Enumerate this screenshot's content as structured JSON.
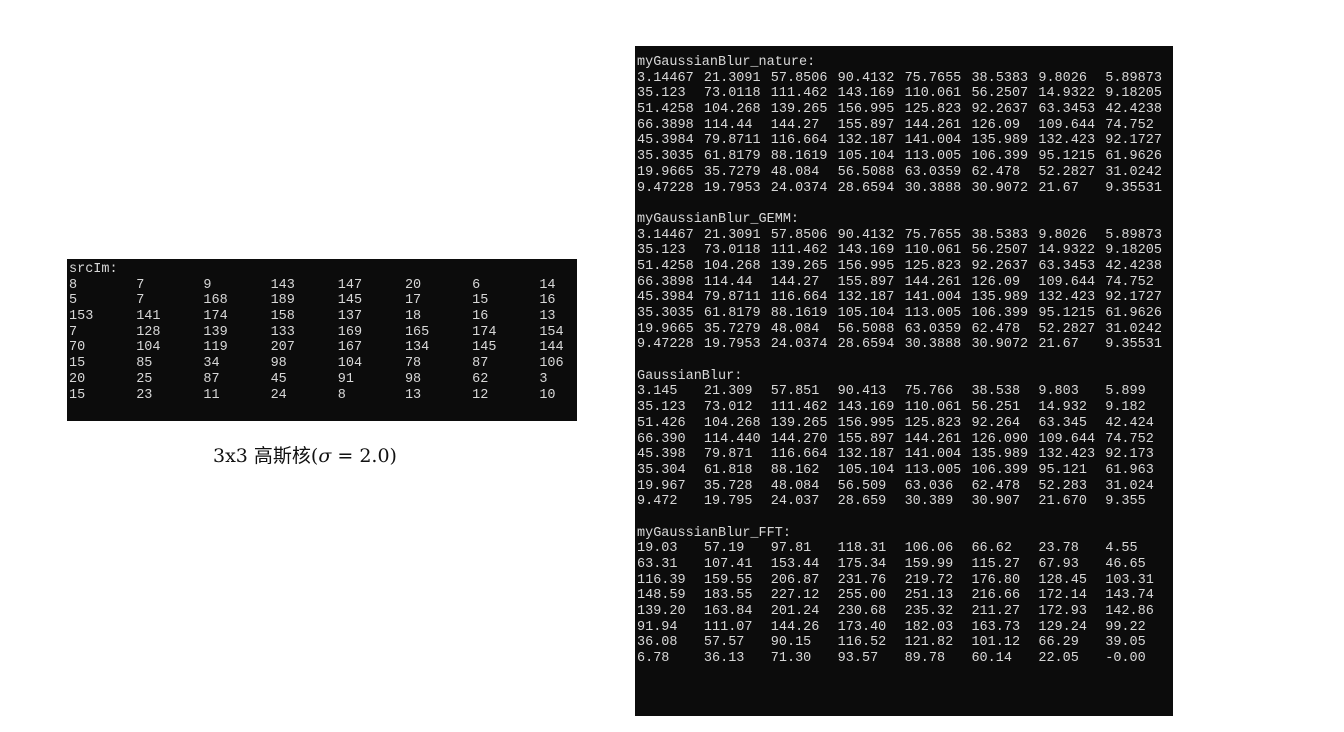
{
  "src_console": {
    "header": "srcIm:",
    "rows": [
      [
        "8",
        "7",
        "9",
        "143",
        "147",
        "20",
        "6",
        "14"
      ],
      [
        "5",
        "7",
        "168",
        "189",
        "145",
        "17",
        "15",
        "16"
      ],
      [
        "153",
        "141",
        "174",
        "158",
        "137",
        "18",
        "16",
        "13"
      ],
      [
        "7",
        "128",
        "139",
        "133",
        "169",
        "165",
        "174",
        "154"
      ],
      [
        "70",
        "104",
        "119",
        "207",
        "167",
        "134",
        "145",
        "144"
      ],
      [
        "15",
        "85",
        "34",
        "98",
        "104",
        "78",
        "87",
        "106"
      ],
      [
        "20",
        "25",
        "87",
        "45",
        "91",
        "98",
        "62",
        "3"
      ],
      [
        "15",
        "23",
        "11",
        "24",
        "8",
        "13",
        "12",
        "10"
      ]
    ]
  },
  "caption": {
    "prefix": "3x3 高斯核(",
    "symbol": "σ",
    "suffix": " = 2.0)"
  },
  "result_console": {
    "blocks": [
      {
        "header": "myGaussianBlur_nature:",
        "rows": [
          [
            "3.14467",
            "21.3091",
            "57.8506",
            "90.4132",
            "75.7655",
            "38.5383",
            "9.8026",
            "5.89873"
          ],
          [
            "35.123",
            "73.0118",
            "111.462",
            "143.169",
            "110.061",
            "56.2507",
            "14.9322",
            "9.18205"
          ],
          [
            "51.4258",
            "104.268",
            "139.265",
            "156.995",
            "125.823",
            "92.2637",
            "63.3453",
            "42.4238"
          ],
          [
            "66.3898",
            "114.44",
            "144.27",
            "155.897",
            "144.261",
            "126.09",
            "109.644",
            "74.752"
          ],
          [
            "45.3984",
            "79.8711",
            "116.664",
            "132.187",
            "141.004",
            "135.989",
            "132.423",
            "92.1727"
          ],
          [
            "35.3035",
            "61.8179",
            "88.1619",
            "105.104",
            "113.005",
            "106.399",
            "95.1215",
            "61.9626"
          ],
          [
            "19.9665",
            "35.7279",
            "48.084",
            "56.5088",
            "63.0359",
            "62.478",
            "52.2827",
            "31.0242"
          ],
          [
            "9.47228",
            "19.7953",
            "24.0374",
            "28.6594",
            "30.3888",
            "30.9072",
            "21.67",
            "9.35531"
          ]
        ]
      },
      {
        "header": "myGaussianBlur_GEMM:",
        "rows": [
          [
            "3.14467",
            "21.3091",
            "57.8506",
            "90.4132",
            "75.7655",
            "38.5383",
            "9.8026",
            "5.89873"
          ],
          [
            "35.123",
            "73.0118",
            "111.462",
            "143.169",
            "110.061",
            "56.2507",
            "14.9322",
            "9.18205"
          ],
          [
            "51.4258",
            "104.268",
            "139.265",
            "156.995",
            "125.823",
            "92.2637",
            "63.3453",
            "42.4238"
          ],
          [
            "66.3898",
            "114.44",
            "144.27",
            "155.897",
            "144.261",
            "126.09",
            "109.644",
            "74.752"
          ],
          [
            "45.3984",
            "79.8711",
            "116.664",
            "132.187",
            "141.004",
            "135.989",
            "132.423",
            "92.1727"
          ],
          [
            "35.3035",
            "61.8179",
            "88.1619",
            "105.104",
            "113.005",
            "106.399",
            "95.1215",
            "61.9626"
          ],
          [
            "19.9665",
            "35.7279",
            "48.084",
            "56.5088",
            "63.0359",
            "62.478",
            "52.2827",
            "31.0242"
          ],
          [
            "9.47228",
            "19.7953",
            "24.0374",
            "28.6594",
            "30.3888",
            "30.9072",
            "21.67",
            "9.35531"
          ]
        ]
      },
      {
        "header": "GaussianBlur:",
        "rows": [
          [
            "3.145",
            "21.309",
            "57.851",
            "90.413",
            "75.766",
            "38.538",
            "9.803",
            "5.899"
          ],
          [
            "35.123",
            "73.012",
            "111.462",
            "143.169",
            "110.061",
            "56.251",
            "14.932",
            "9.182"
          ],
          [
            "51.426",
            "104.268",
            "139.265",
            "156.995",
            "125.823",
            "92.264",
            "63.345",
            "42.424"
          ],
          [
            "66.390",
            "114.440",
            "144.270",
            "155.897",
            "144.261",
            "126.090",
            "109.644",
            "74.752"
          ],
          [
            "45.398",
            "79.871",
            "116.664",
            "132.187",
            "141.004",
            "135.989",
            "132.423",
            "92.173"
          ],
          [
            "35.304",
            "61.818",
            "88.162",
            "105.104",
            "113.005",
            "106.399",
            "95.121",
            "61.963"
          ],
          [
            "19.967",
            "35.728",
            "48.084",
            "56.509",
            "63.036",
            "62.478",
            "52.283",
            "31.024"
          ],
          [
            "9.472",
            "19.795",
            "24.037",
            "28.659",
            "30.389",
            "30.907",
            "21.670",
            "9.355"
          ]
        ]
      },
      {
        "header": "myGaussianBlur_FFT:",
        "rows": [
          [
            "19.03",
            "57.19",
            "97.81",
            "118.31",
            "106.06",
            "66.62",
            "23.78",
            "4.55"
          ],
          [
            "63.31",
            "107.41",
            "153.44",
            "175.34",
            "159.99",
            "115.27",
            "67.93",
            "46.65"
          ],
          [
            "116.39",
            "159.55",
            "206.87",
            "231.76",
            "219.72",
            "176.80",
            "128.45",
            "103.31"
          ],
          [
            "148.59",
            "183.55",
            "227.12",
            "255.00",
            "251.13",
            "216.66",
            "172.14",
            "143.74"
          ],
          [
            "139.20",
            "163.84",
            "201.24",
            "230.68",
            "235.32",
            "211.27",
            "172.93",
            "142.86"
          ],
          [
            "91.94",
            "111.07",
            "144.26",
            "173.40",
            "182.03",
            "163.73",
            "129.24",
            "99.22"
          ],
          [
            "36.08",
            "57.57",
            "90.15",
            "116.52",
            "121.82",
            "101.12",
            "66.29",
            "39.05"
          ],
          [
            "6.78",
            "36.13",
            "71.30",
            "93.57",
            "89.78",
            "60.14",
            "22.05",
            "-0.00"
          ]
        ]
      }
    ]
  }
}
